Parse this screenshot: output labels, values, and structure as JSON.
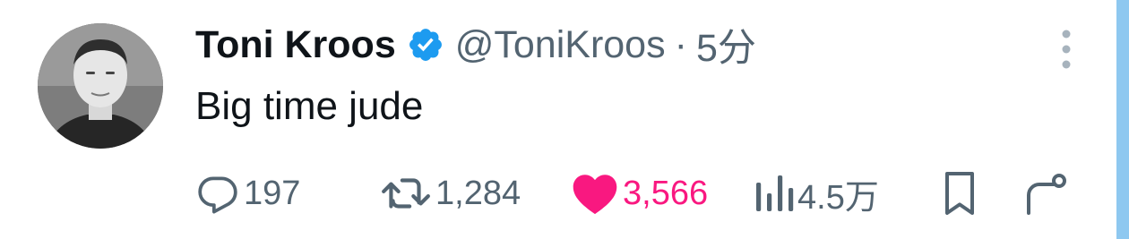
{
  "tweet": {
    "author": {
      "display_name": "Toni Kroos",
      "handle": "@ToniKroos",
      "verified": true,
      "avatar_icon": "profile-photo"
    },
    "separator": "·",
    "time": "5分",
    "text": "Big time jude",
    "actions": {
      "replies": {
        "count": "197",
        "icon": "comment-icon"
      },
      "retweets": {
        "count": "1,284",
        "icon": "retweet-icon"
      },
      "likes": {
        "count": "3,566",
        "icon": "heart-icon",
        "liked": true
      },
      "views": {
        "count": "4.5万",
        "icon": "bar-chart-icon"
      },
      "bookmark": {
        "icon": "bookmark-icon"
      },
      "share": {
        "icon": "share-icon"
      }
    }
  },
  "colors": {
    "text_primary": "#0f1419",
    "text_secondary": "#536471",
    "verified_blue": "#1d9bf0",
    "like_pink": "#f91880",
    "scroll_strip": "#8ec8f0"
  }
}
